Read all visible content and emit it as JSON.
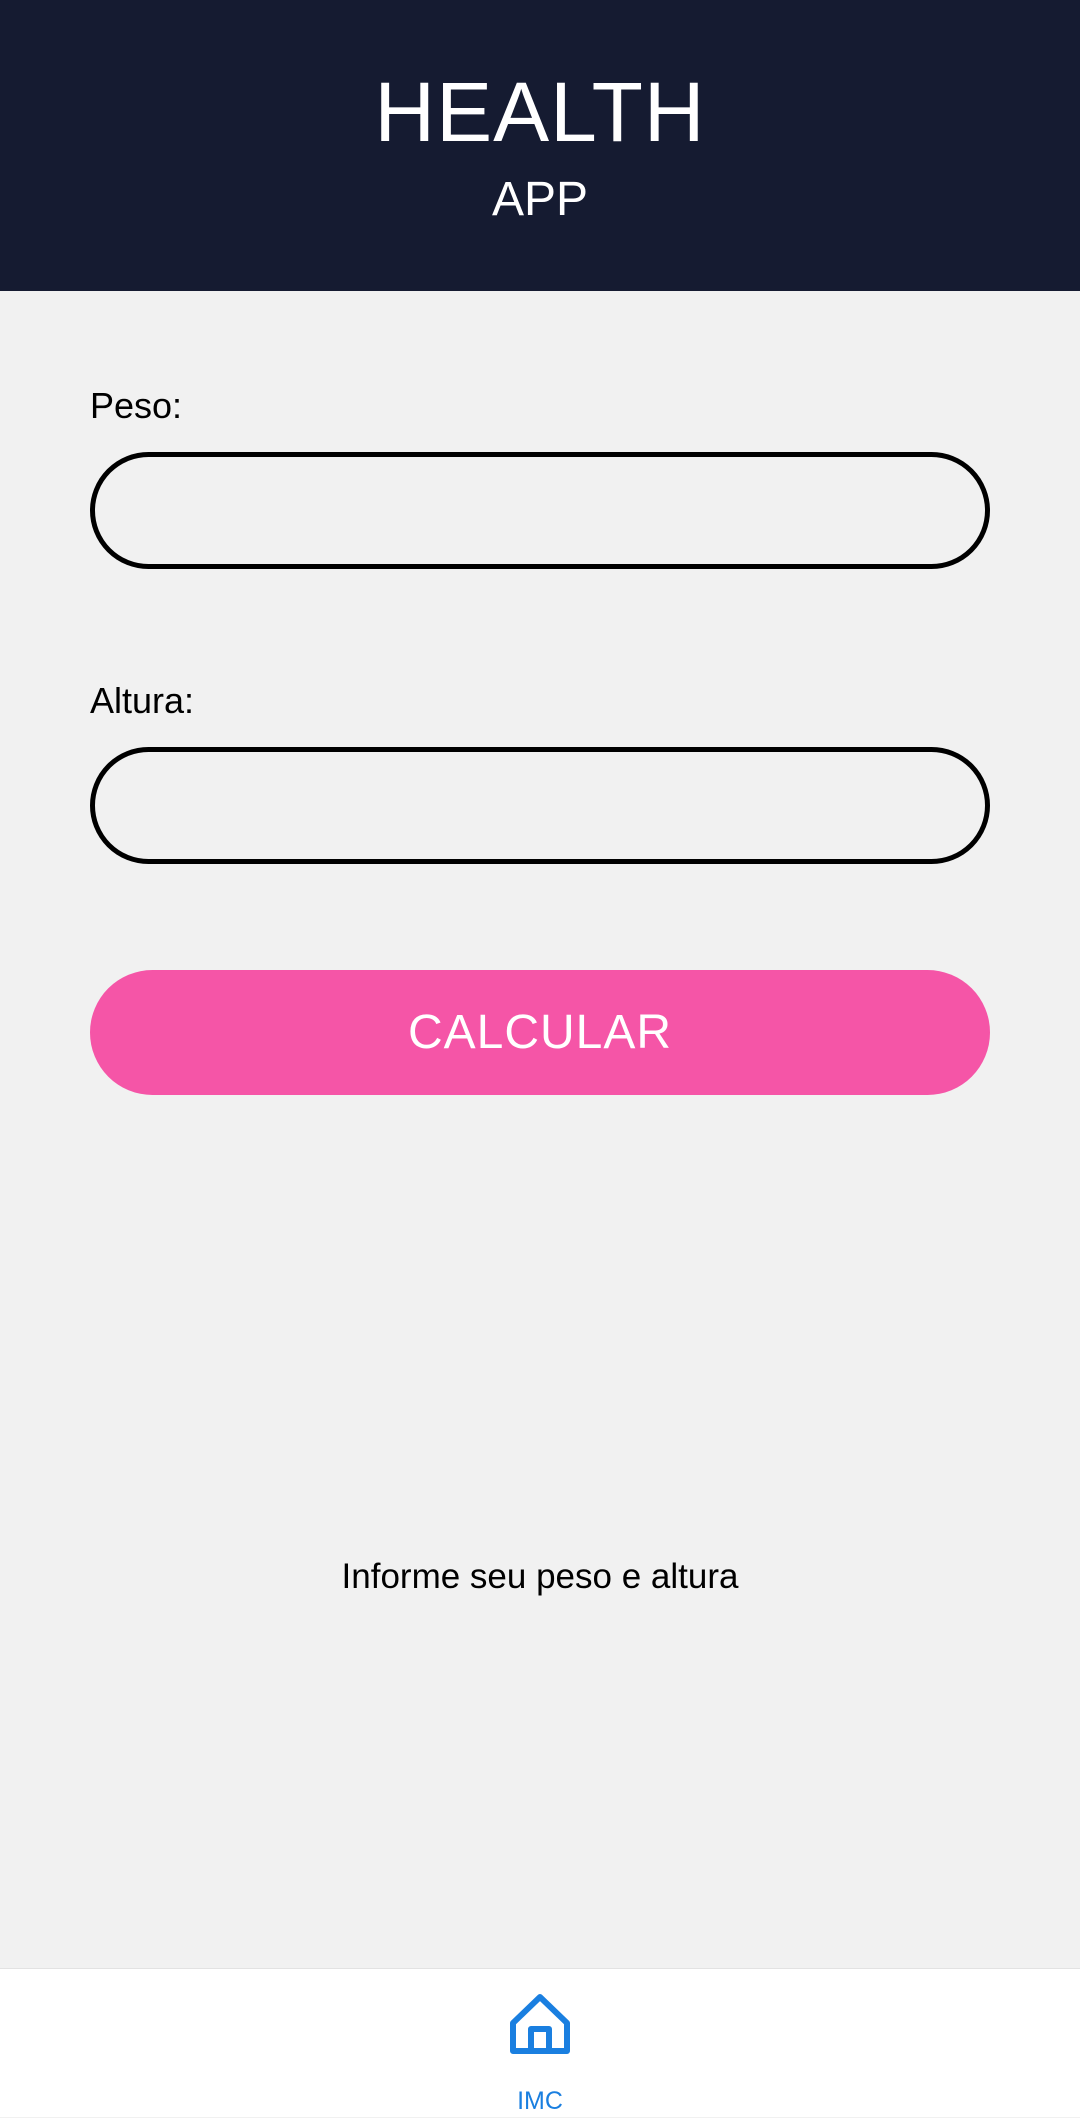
{
  "header": {
    "title": "HEALTH",
    "subtitle": "APP"
  },
  "form": {
    "weight_label": "Peso:",
    "weight_value": "",
    "height_label": "Altura:",
    "height_value": "",
    "calculate_label": "CALCULAR"
  },
  "result": {
    "message": "Informe seu peso e altura"
  },
  "bottom_nav": {
    "items": [
      {
        "label": "IMC",
        "icon": "home-icon",
        "active": true
      }
    ]
  },
  "colors": {
    "header_bg": "#151b31",
    "page_bg": "#f1f1f1",
    "button_bg": "#f555a7",
    "nav_accent": "#1a7fe0"
  }
}
